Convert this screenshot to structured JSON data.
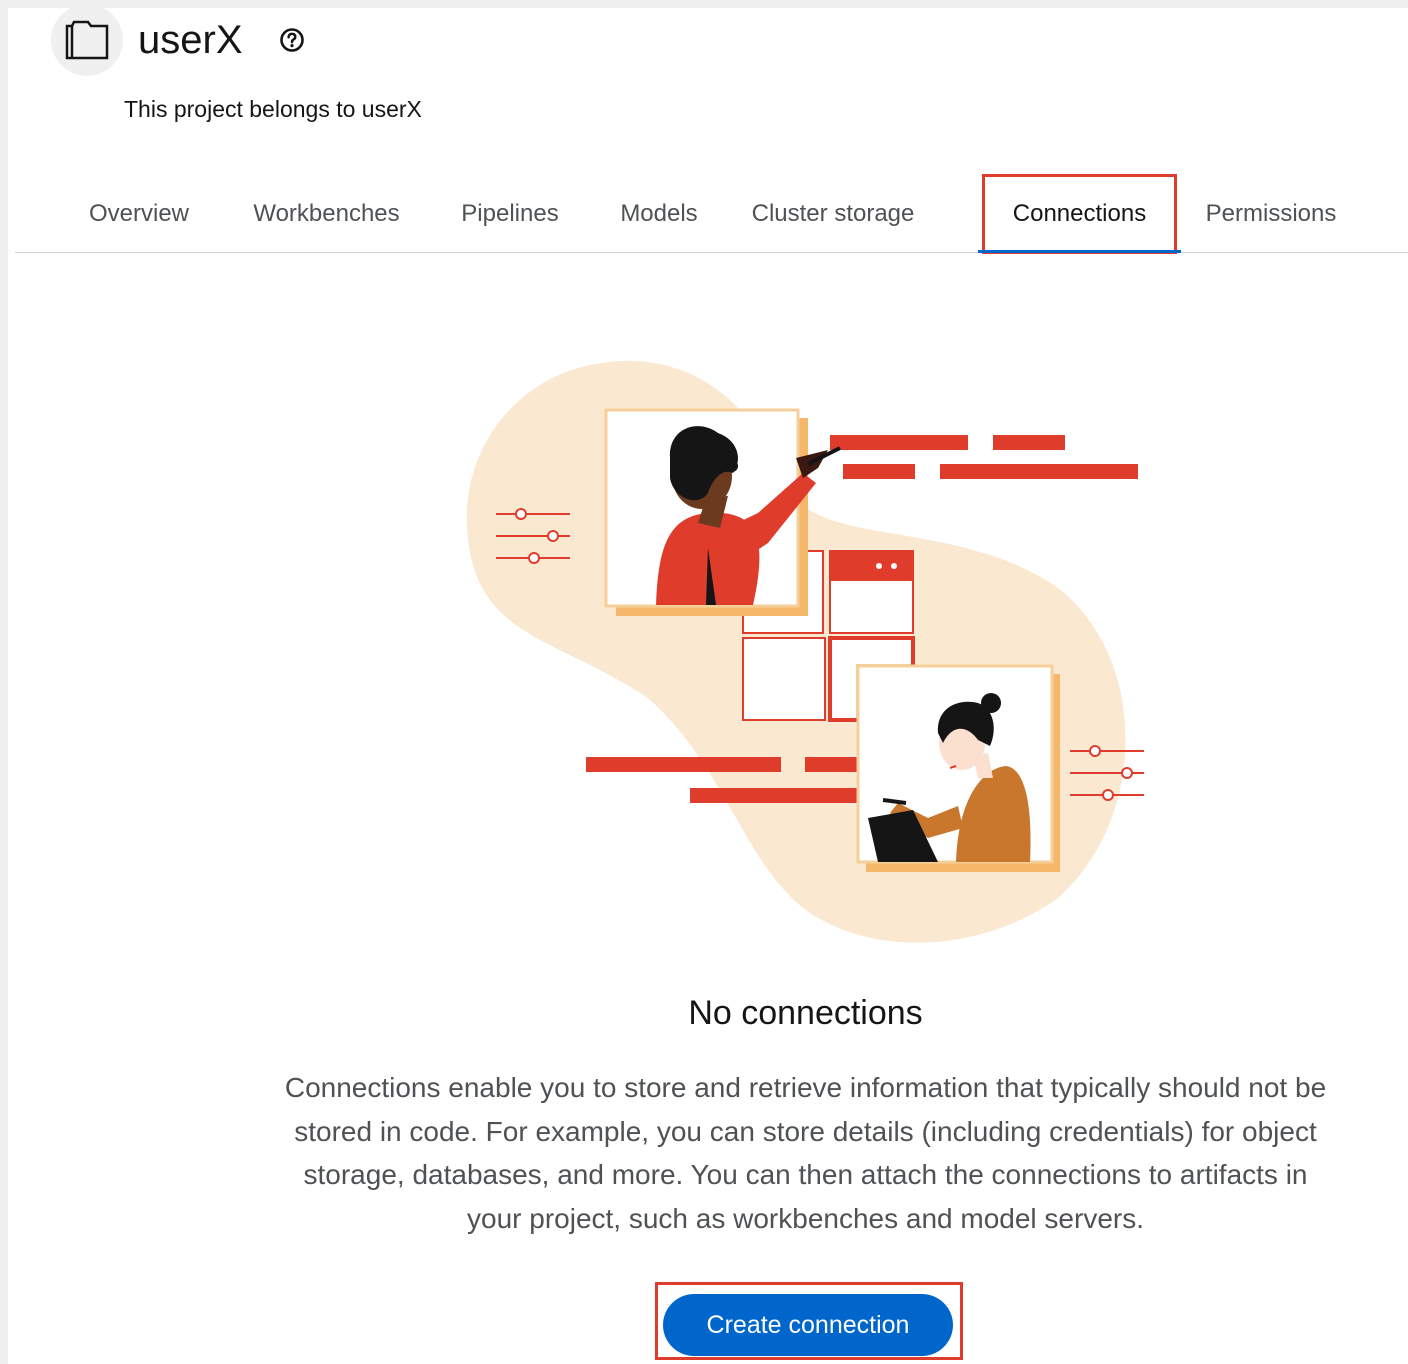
{
  "project": {
    "icon": "project-folder-icon",
    "title": "userX",
    "help_icon": "question-circle-icon",
    "description": "This project belongs to userX"
  },
  "tabs": [
    {
      "label": "Overview",
      "active": false
    },
    {
      "label": "Workbenches",
      "active": false
    },
    {
      "label": "Pipelines",
      "active": false
    },
    {
      "label": "Models",
      "active": false
    },
    {
      "label": "Cluster storage",
      "active": false
    },
    {
      "label": "Connections",
      "active": true
    },
    {
      "label": "Permissions",
      "active": false
    }
  ],
  "empty_state": {
    "title": "No connections",
    "body": "Connections enable you to store and retrieve information that typically should not be stored in code. For example, you can store details (including credentials) for object storage, databases, and more. You can then attach the connections to artifacts in your project, such as workbenches and model servers.",
    "button_label": "Create connection"
  },
  "colors": {
    "accent_blue": "#0066cc",
    "illustration_red": "#e03c2c",
    "illustration_peach": "#fbe8d0",
    "highlight_outline": "#e03c2c"
  }
}
